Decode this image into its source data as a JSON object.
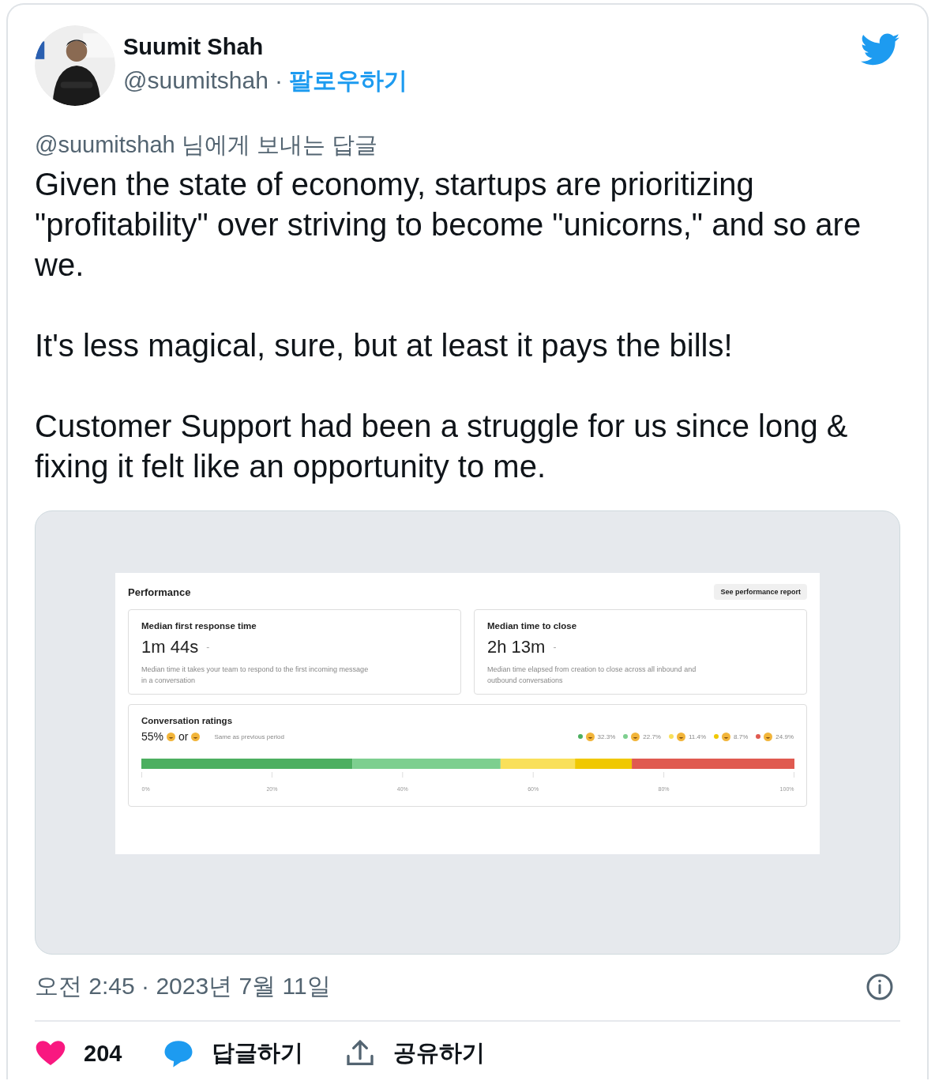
{
  "tweet": {
    "author": {
      "name": "Suumit Shah",
      "handle": "@suumitshah",
      "separator": "·",
      "follow": "팔로우하기"
    },
    "reply_to": "@suumitshah 님에게 보내는 답글",
    "paragraphs": [
      "Given the state of economy, startups are prioritizing \"profitability\" over striving to become \"unicorns,\" and so are we.",
      "It's less magical, sure, but at least it pays the bills!",
      "Customer Support had been a struggle for us since long & fixing it felt like an opportunity to me."
    ],
    "media": {
      "title": "Performance",
      "report_button": "See performance report",
      "metrics": [
        {
          "title": "Median first response time",
          "value": "1m 44s",
          "trend": "-",
          "description": "Median time it takes your team to respond to the first incoming message in a conversation"
        },
        {
          "title": "Median time to close",
          "value": "2h 13m",
          "trend": "-",
          "description": "Median time elapsed from creation to close across all inbound and outbound conversations"
        }
      ],
      "ratings": {
        "title": "Conversation ratings",
        "score": "55%",
        "connector": "or",
        "comparison": "Same as previous period",
        "legend": [
          {
            "color": "#4caf60",
            "label": "32.3%"
          },
          {
            "color": "#7dcf8f",
            "label": "22.7%"
          },
          {
            "color": "#f9e05a",
            "label": "11.4%"
          },
          {
            "color": "#f0c800",
            "label": "8.7%"
          },
          {
            "color": "#e05a50",
            "label": "24.9%"
          }
        ],
        "chart_data": {
          "type": "bar",
          "orientation": "horizontal",
          "stacked": true,
          "xlim": [
            0,
            100
          ],
          "xticks": [
            {
              "value": 0,
              "label": "0%"
            },
            {
              "value": 20,
              "label": "20%"
            },
            {
              "value": 40,
              "label": "40%"
            },
            {
              "value": 60,
              "label": "60%"
            },
            {
              "value": 80,
              "label": "80%"
            },
            {
              "value": 100,
              "label": "100%"
            }
          ],
          "series": [
            {
              "color": "#4caf60",
              "values": [
                32.3
              ]
            },
            {
              "color": "#7dcf8f",
              "values": [
                22.7
              ]
            },
            {
              "color": "#f9e05a",
              "values": [
                11.4
              ]
            },
            {
              "color": "#f0c800",
              "values": [
                8.7
              ]
            },
            {
              "color": "#e05a50",
              "values": [
                24.9
              ]
            }
          ]
        }
      }
    },
    "timestamp": "오전 2:45 · 2023년 7월 11일",
    "actions": [
      {
        "kind": "like",
        "label": "204"
      },
      {
        "kind": "reply",
        "label": "답글하기"
      },
      {
        "kind": "share",
        "label": "공유하기"
      }
    ]
  }
}
